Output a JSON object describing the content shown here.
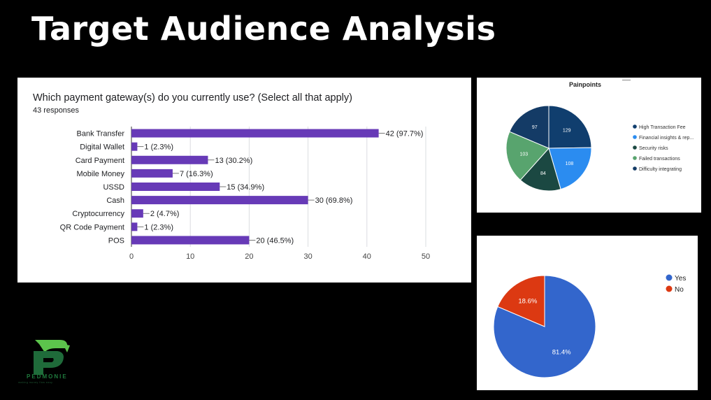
{
  "slide": {
    "title": "Target Audience Analysis"
  },
  "logo": {
    "name": "PEDMONIE",
    "tagline": "making money flow easy"
  },
  "colors": {
    "bar": "#673ab7",
    "yes": "#3366cc",
    "no": "#dc3912"
  },
  "chart_data": [
    {
      "type": "bar",
      "orientation": "horizontal",
      "title": "Which payment gateway(s) do you currently use? (Select all that apply)",
      "subtitle": "43 responses",
      "categories": [
        "Bank Transfer",
        "Digital Wallet",
        "Card Payment",
        "Mobile Money",
        "USSD",
        "Cash",
        "Cryptocurrency",
        "QR Code Payment",
        "POS"
      ],
      "values": [
        42,
        1,
        13,
        7,
        15,
        30,
        2,
        1,
        20
      ],
      "data_labels": [
        "42 (97.7%)",
        "1 (2.3%)",
        "13 (30.2%)",
        "7 (16.3%)",
        "15 (34.9%)",
        "30 (69.8%)",
        "2 (4.7%)",
        "1 (2.3%)",
        "20 (46.5%)"
      ],
      "xlim": [
        0,
        50
      ],
      "xticks": [
        "0",
        "10",
        "20",
        "30",
        "40",
        "50"
      ],
      "grid": true
    },
    {
      "type": "pie",
      "title": "Painpoints",
      "legend_position": "right",
      "slices": [
        {
          "label": "High Transaction Fee",
          "value": 129,
          "color": "#103e6e"
        },
        {
          "label": "Financial insights & rep...",
          "value": 108,
          "color": "#2b8cf0"
        },
        {
          "label": "Security risks",
          "value": 84,
          "color": "#1b4842"
        },
        {
          "label": "Failed transactions",
          "value": 103,
          "color": "#58a46e"
        },
        {
          "label": "Difficulty integrating",
          "value": 97,
          "color": "#143b66"
        }
      ]
    },
    {
      "type": "pie",
      "legend_position": "top-right",
      "slices": [
        {
          "label": "Yes",
          "value": 81.4,
          "text": "81.4%",
          "color": "#3366cc"
        },
        {
          "label": "No",
          "value": 18.6,
          "text": "18.6%",
          "color": "#dc3912"
        }
      ]
    }
  ]
}
